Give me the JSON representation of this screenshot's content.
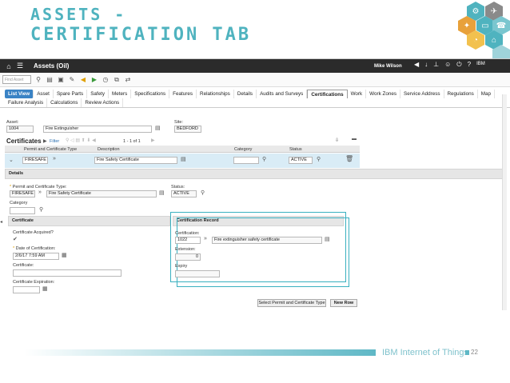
{
  "slide": {
    "title_line1": "Assets -",
    "title_line2": "Certification Tab",
    "footer_brand": "IBM Internet of Things",
    "page_number": "22"
  },
  "colors": {
    "accent": "#4fb3bf",
    "topbar": "#2b2b2b",
    "listview": "#3a83c5"
  },
  "header": {
    "app_title": "Assets (Oil)",
    "user": "Mike Wilson",
    "brand": "IBM"
  },
  "toolbar": {
    "find_placeholder": "Find Asset"
  },
  "tabs": [
    "List View",
    "Asset",
    "Spare Parts",
    "Safety",
    "Meters",
    "Specifications",
    "Features",
    "Relationships",
    "Details",
    "Audits and Surveys",
    "Certifications",
    "Work",
    "Work Zones",
    "Service Address",
    "Regulations",
    "Map",
    "Failure Analysis",
    "Calculations",
    "Review Actions"
  ],
  "active_tab": "Certifications",
  "asset": {
    "asset_label": "Asset:",
    "asset_value": "1004",
    "description_value": "Fire Extinguisher",
    "site_label": "Site:",
    "site_value": "BEDFORD"
  },
  "certificates": {
    "title": "Certificates",
    "filter_label": "Filter",
    "pagination": "1 - 1 of 1",
    "columns": [
      "Permit and Certificate Type",
      "Description",
      "Category",
      "Status"
    ],
    "row": {
      "type": "FIRESAFE",
      "description": "Fire Safety Certificate",
      "category": "",
      "status": "ACTIVE"
    }
  },
  "details": {
    "section_label": "Details",
    "permit_label": "Permit and Certificate Type:",
    "permit_value": "FIRESAFE",
    "permit_desc": "Fire Safety Certificate",
    "status_label": "Status:",
    "status_value": "ACTIVE",
    "category_label": "Category"
  },
  "certificate": {
    "section_label": "Certificate",
    "acquired_label": "Certificate Acquired?",
    "date_label": "Date of Certification:",
    "date_value": "2/6/17 7:59 AM",
    "cert_label": "Certificate:",
    "expiration_label": "Certificate Expiration:"
  },
  "cert_record": {
    "section_label": "Certification Record",
    "cert_label": "Certification:",
    "cert_value": "1022",
    "cert_desc": "Fire extinguisher safety certificate",
    "extension_label": "Extension:",
    "extension_value": "0",
    "expiry_label": "Expiry"
  },
  "buttons": {
    "select": "Select Permit and Certificate Type",
    "new_row": "New Row"
  }
}
